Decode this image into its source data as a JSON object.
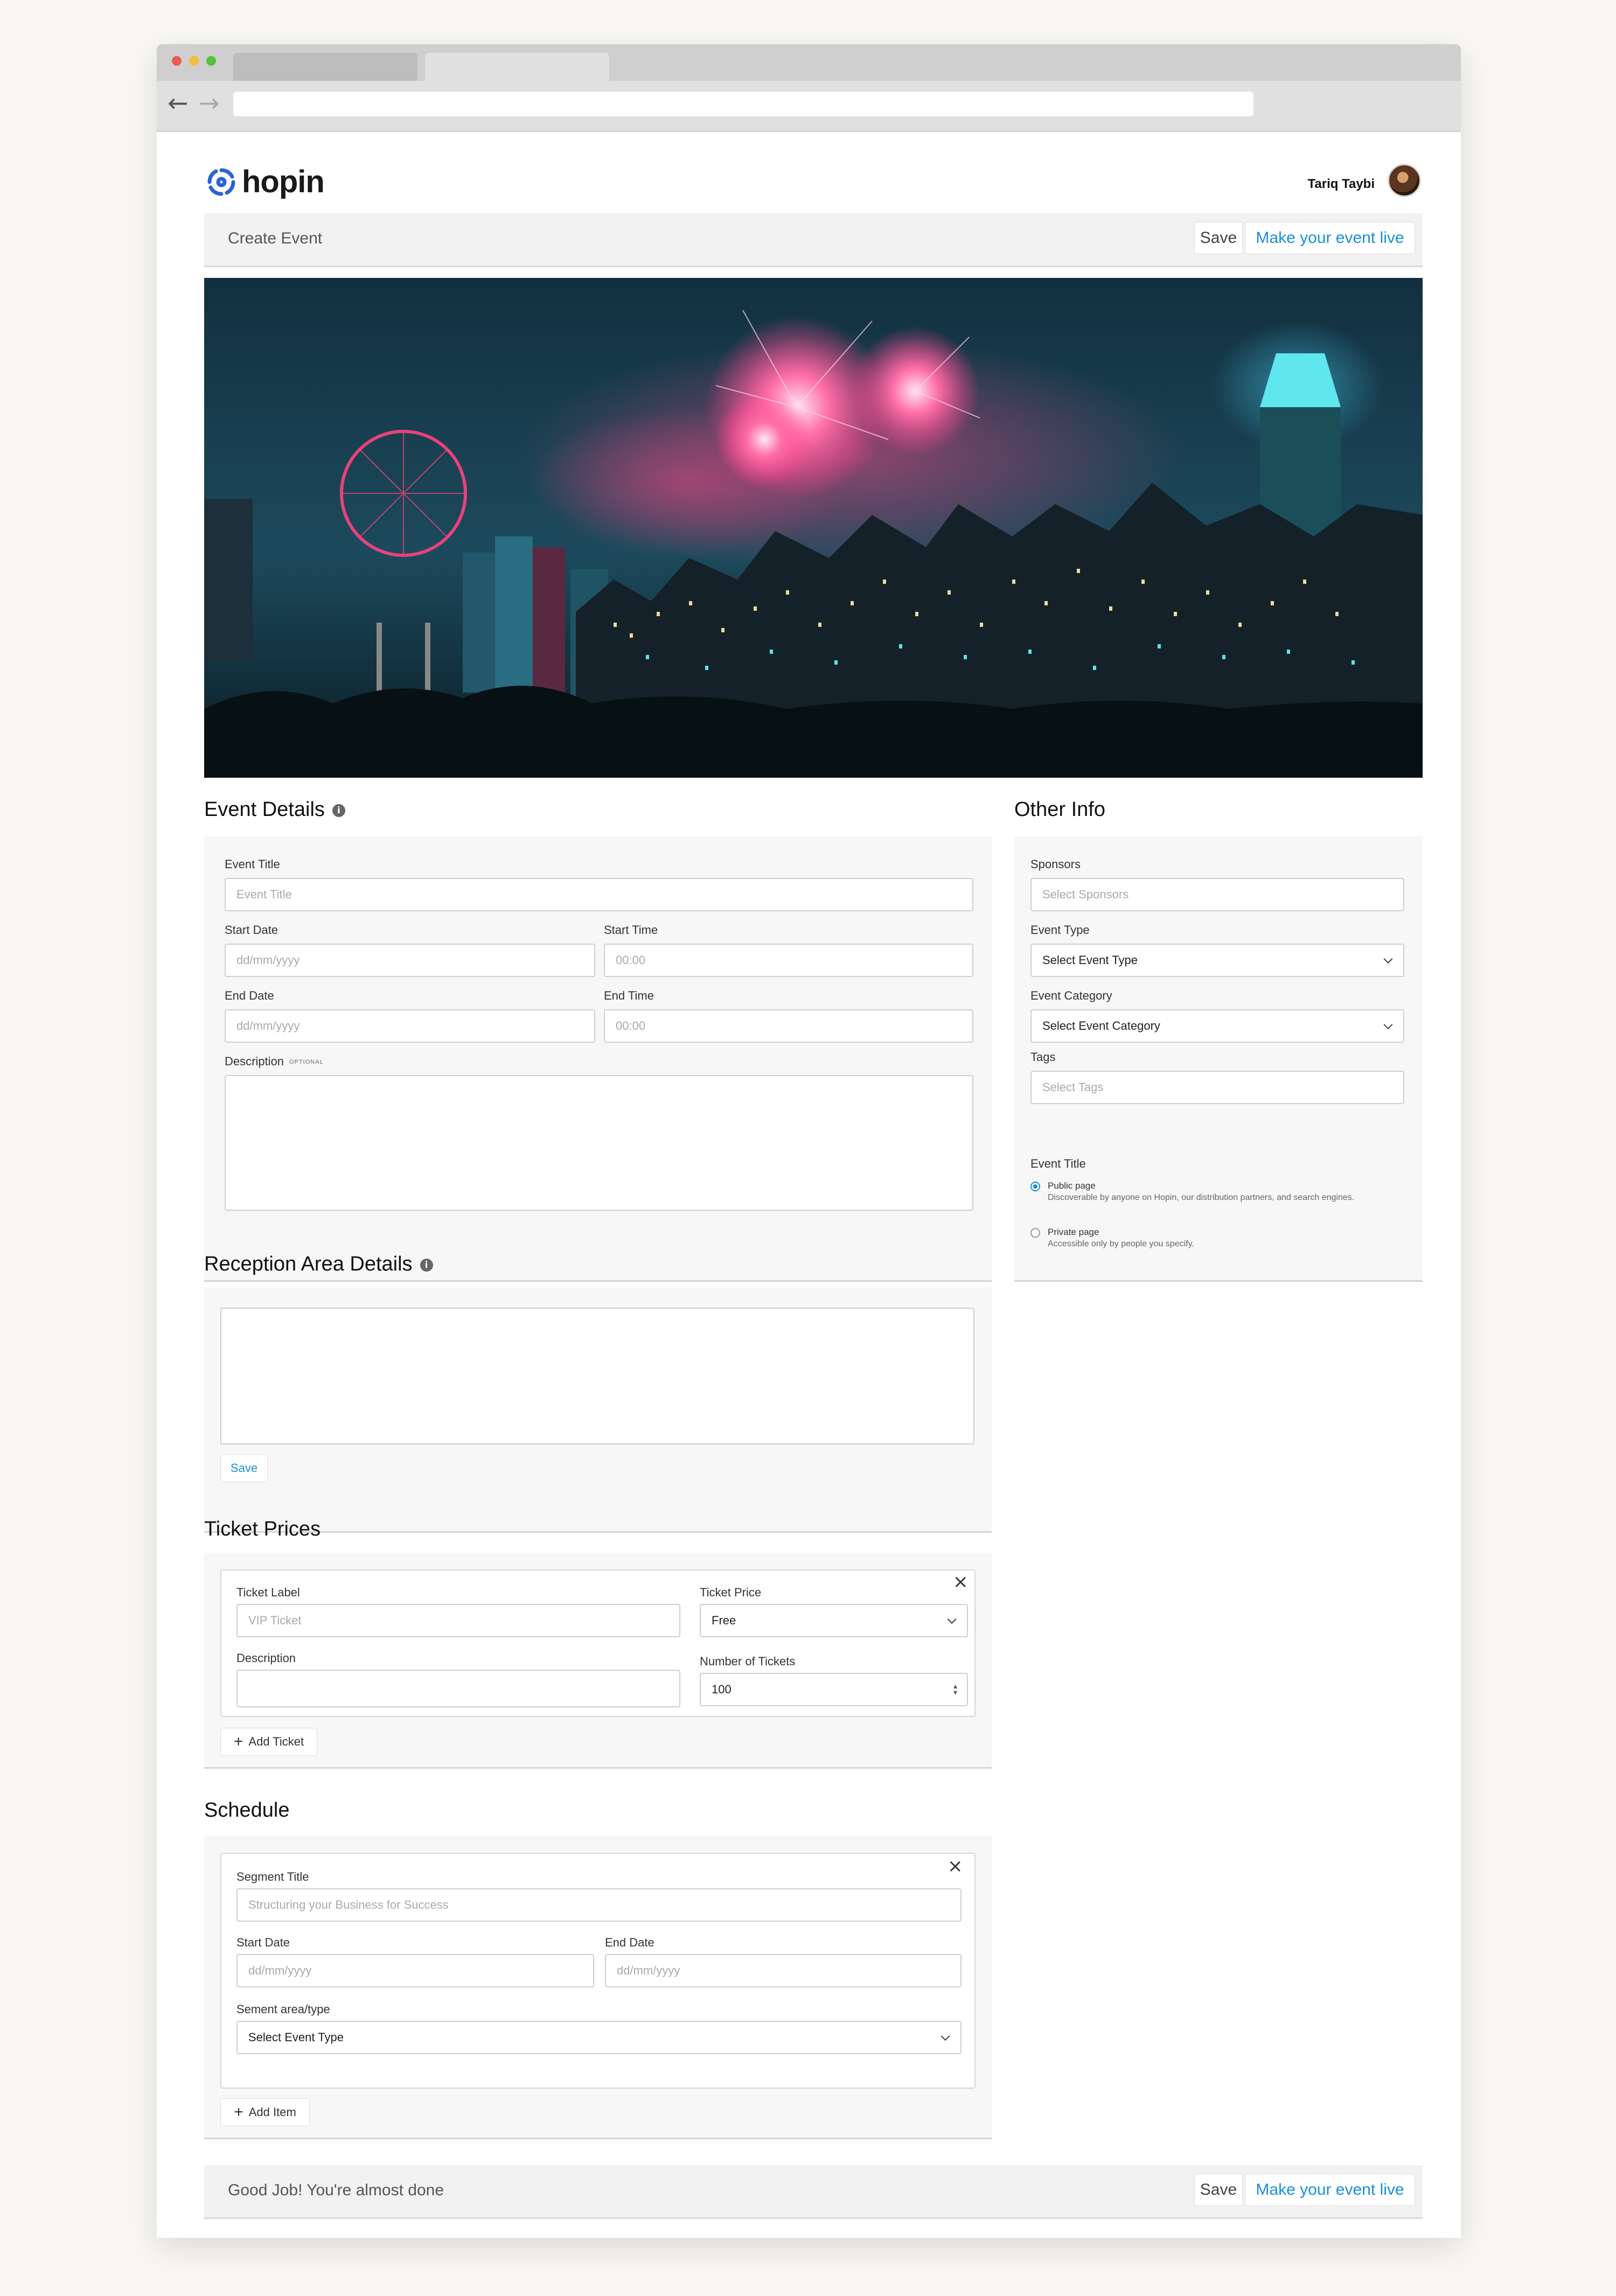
{
  "app": {
    "logo_text": "hopin",
    "user_name": "Tariq Taybi"
  },
  "topbar": {
    "title": "Create Event",
    "save_label": "Save",
    "live_label": "Make your event live"
  },
  "event_details": {
    "title": "Event Details",
    "event_title_label": "Event Title",
    "event_title_placeholder": "Event Title",
    "start_date_label": "Start Date",
    "start_date_placeholder": "dd/mm/yyyy",
    "start_time_label": "Start Time",
    "start_time_placeholder": "00:00",
    "end_date_label": "End Date",
    "end_date_placeholder": "dd/mm/yyyy",
    "end_time_label": "End Time",
    "end_time_placeholder": "00:00",
    "description_label": "Description",
    "description_optional": "OPTIONAL"
  },
  "other_info": {
    "title": "Other Info",
    "sponsors_label": "Sponsors",
    "sponsors_placeholder": "Select Sponsors",
    "event_type_label": "Event Type",
    "event_type_value": "Select Event Type",
    "event_category_label": "Event Category",
    "event_category_value": "Select Event Category",
    "tags_label": "Tags",
    "tags_placeholder": "Select Tags",
    "visibility_label": "Event Title",
    "public_title": "Public page",
    "public_desc": "Discoverable by anyone on Hopin, our distribution partners, and search engines.",
    "private_title": "Private page",
    "private_desc": "Accessible only by people you specify."
  },
  "reception": {
    "title": "Reception Area Details",
    "save_label": "Save"
  },
  "tickets": {
    "title": "Ticket Prices",
    "label_label": "Ticket Label",
    "label_placeholder": "VIP Ticket",
    "price_label": "Ticket Price",
    "price_value": "Free",
    "description_label": "Description",
    "number_label": "Number of Tickets",
    "number_value": "100",
    "add_label": "Add Ticket"
  },
  "schedule": {
    "title": "Schedule",
    "segment_title_label": "Segment Title",
    "segment_title_placeholder": "Structuring your Business for Success",
    "start_date_label": "Start Date",
    "start_date_placeholder": "dd/mm/yyyy",
    "end_date_label": "End Date",
    "end_date_placeholder": "dd/mm/yyyy",
    "segment_type_label": "Sement area/type",
    "segment_type_value": "Select Event Type",
    "add_label": "Add Item"
  },
  "footer": {
    "message": "Good Job! You're almost done",
    "save_label": "Save",
    "live_label": "Make your event live"
  },
  "colors": {
    "accent": "#1a8fd8",
    "logo": "#2a62d8"
  }
}
